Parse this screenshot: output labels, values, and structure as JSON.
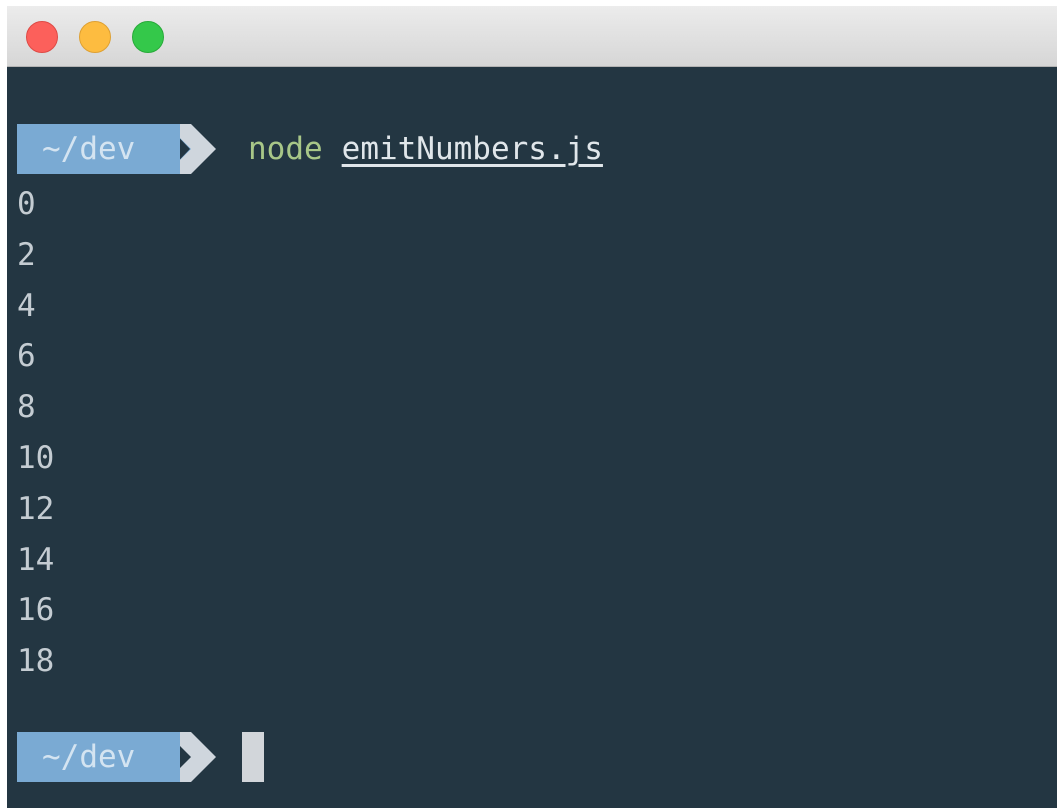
{
  "window": {
    "controls": [
      "close",
      "minimize",
      "zoom"
    ]
  },
  "terminal": {
    "prompt_dir": "~/dev",
    "command": {
      "program": "node",
      "argument": "emitNumbers.js"
    },
    "output_lines": [
      "0",
      "2",
      "4",
      "6",
      "8",
      "10",
      "12",
      "14",
      "16",
      "18"
    ],
    "colors": {
      "background": "#233642",
      "prompt_segment": "#7aaad3",
      "prompt_arrow": "#cfd6dd",
      "command_program": "#a8c788",
      "output_text": "#c4ccd2"
    }
  }
}
